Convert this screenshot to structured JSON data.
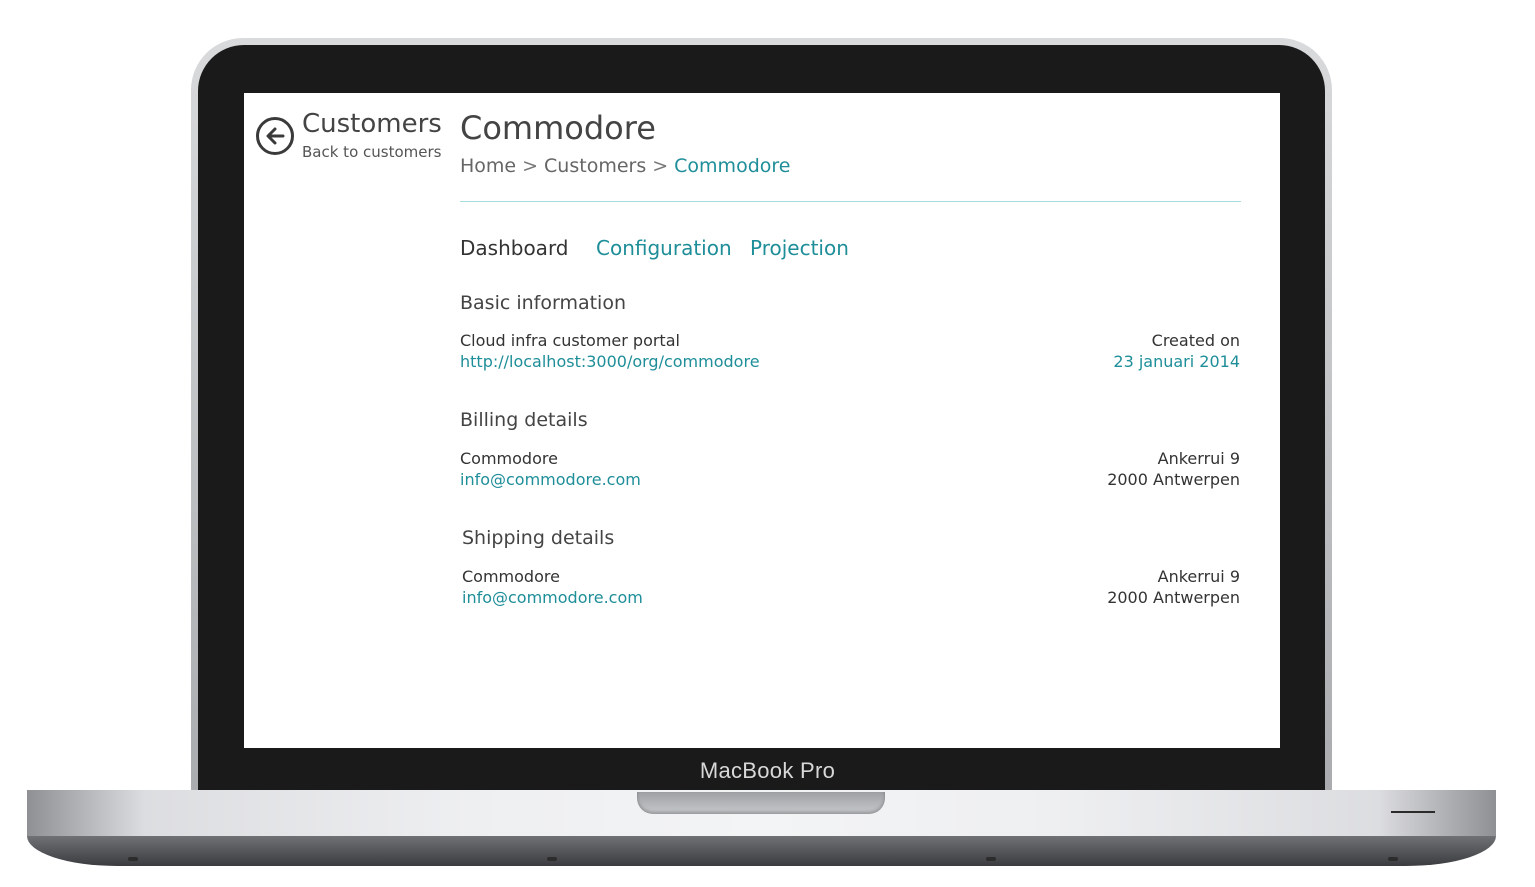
{
  "device": {
    "brand": "MacBook Pro"
  },
  "nav": {
    "title": "Customers",
    "subtitle": "Back to customers"
  },
  "page": {
    "title": "Commodore",
    "breadcrumbs": [
      "Home",
      "Customers",
      "Commodore"
    ],
    "breadcrumb_separator": ">"
  },
  "tabs": [
    {
      "label": "Dashboard",
      "active": true
    },
    {
      "label": "Configuration",
      "active": false
    },
    {
      "label": "Projection",
      "active": false
    }
  ],
  "basic": {
    "title": "Basic information",
    "name": "Cloud infra customer portal",
    "url": "http://localhost:3000/org/commodore",
    "created_label": "Created on",
    "created_value": "23 januari 2014"
  },
  "billing": {
    "title": "Billing details",
    "name": "Commodore",
    "email": "info@commodore.com",
    "street": "Ankerrui 9",
    "city": "2000 Antwerpen"
  },
  "shipping": {
    "title": "Shipping details",
    "name": "Commodore",
    "email": "info@commodore.com",
    "street": "Ankerrui 9",
    "city": "2000 Antwerpen"
  },
  "colors": {
    "accent": "#1e8e99",
    "text": "#444444",
    "rule": "#a8dde0"
  },
  "icons": [
    "back-arrow-icon"
  ]
}
